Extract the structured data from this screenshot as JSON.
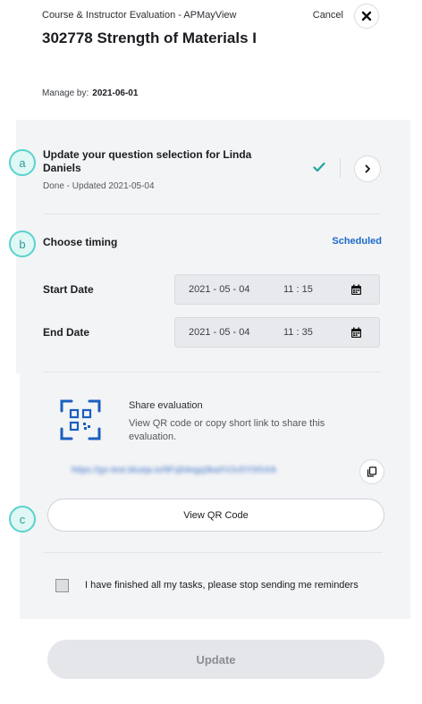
{
  "header": {
    "subtitle": "Course & Instructor Evaluation - APMayView",
    "cancel_label": "Cancel",
    "title": "302778 Strength of Materials I",
    "manage_label": "Manage by:",
    "manage_date": "2021-06-01"
  },
  "steps": [
    {
      "badge": "a",
      "title_line1": "Update your question selection for Linda",
      "title_line2": "Daniels",
      "status": "Done - Updated 2021-05-04",
      "status_color": "#1aa79a"
    },
    {
      "badge": "b",
      "title": "Choose timing",
      "mode_label": "Scheduled"
    },
    {
      "badge": "c"
    }
  ],
  "timing": {
    "start_label": "Start Date",
    "start_date": "2021 - 05 - 04",
    "start_time": "11 : 15",
    "end_label": "End Date",
    "end_date": "2021 - 05 - 04",
    "end_time": "11 : 35"
  },
  "share": {
    "title": "Share evaluation",
    "description": "View QR code or copy short link to share this evaluation.",
    "short_link": "https://go-test.blueja.io/9Fq54egq3kaXV2v5YtXhXA",
    "qr_button_label": "View QR Code",
    "qr_icon_color": "#1b5fc0"
  },
  "reminder": {
    "label": "I have finished all my tasks, please stop sending me reminders",
    "checked": false
  },
  "footer": {
    "update_label": "Update"
  },
  "icons": {
    "close": "close-icon",
    "check": "check-icon",
    "chevron": "chevron-right-icon",
    "calendar": "calendar-icon",
    "qr": "qr-code-icon",
    "copy": "copy-icon"
  }
}
